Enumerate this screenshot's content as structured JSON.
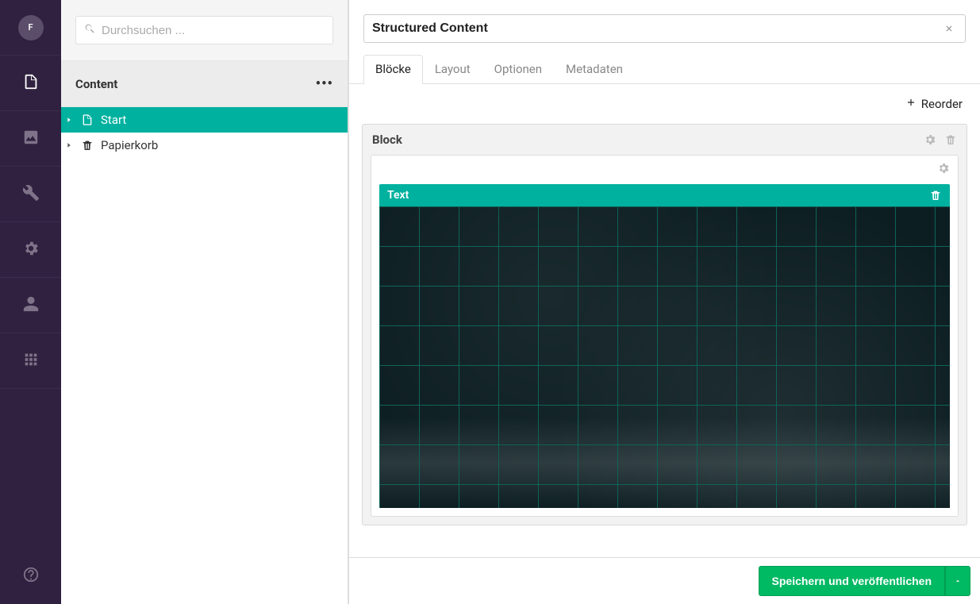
{
  "nav": {
    "avatar_initial": "F",
    "items": [
      {
        "icon": "document-icon",
        "active": true
      },
      {
        "icon": "image-icon",
        "active": false
      },
      {
        "icon": "wrench-icon",
        "active": false
      },
      {
        "icon": "gear-icon",
        "active": false
      },
      {
        "icon": "user-icon",
        "active": false
      },
      {
        "icon": "grid-icon",
        "active": false
      }
    ],
    "help_icon": "help-icon"
  },
  "search": {
    "placeholder": "Durchsuchen ..."
  },
  "section": {
    "title": "Content"
  },
  "tree": {
    "items": [
      {
        "label": "Start",
        "icon": "document-icon",
        "active": true
      },
      {
        "label": "Papierkorb",
        "icon": "trash-icon",
        "active": false
      }
    ]
  },
  "editor": {
    "title_value": "Structured Content",
    "tabs": [
      {
        "label": "Blöcke",
        "active": true
      },
      {
        "label": "Layout",
        "active": false
      },
      {
        "label": "Optionen",
        "active": false
      },
      {
        "label": "Metadaten",
        "active": false
      }
    ],
    "reorder_label": "Reorder",
    "block": {
      "header_label": "Block",
      "text_component_label": "Text"
    }
  },
  "footer": {
    "publish_label": "Speichern und veröffentlichen"
  },
  "colors": {
    "nav_bg": "#2f213f",
    "accent_teal": "#00b19f",
    "publish_green": "#00b963"
  }
}
